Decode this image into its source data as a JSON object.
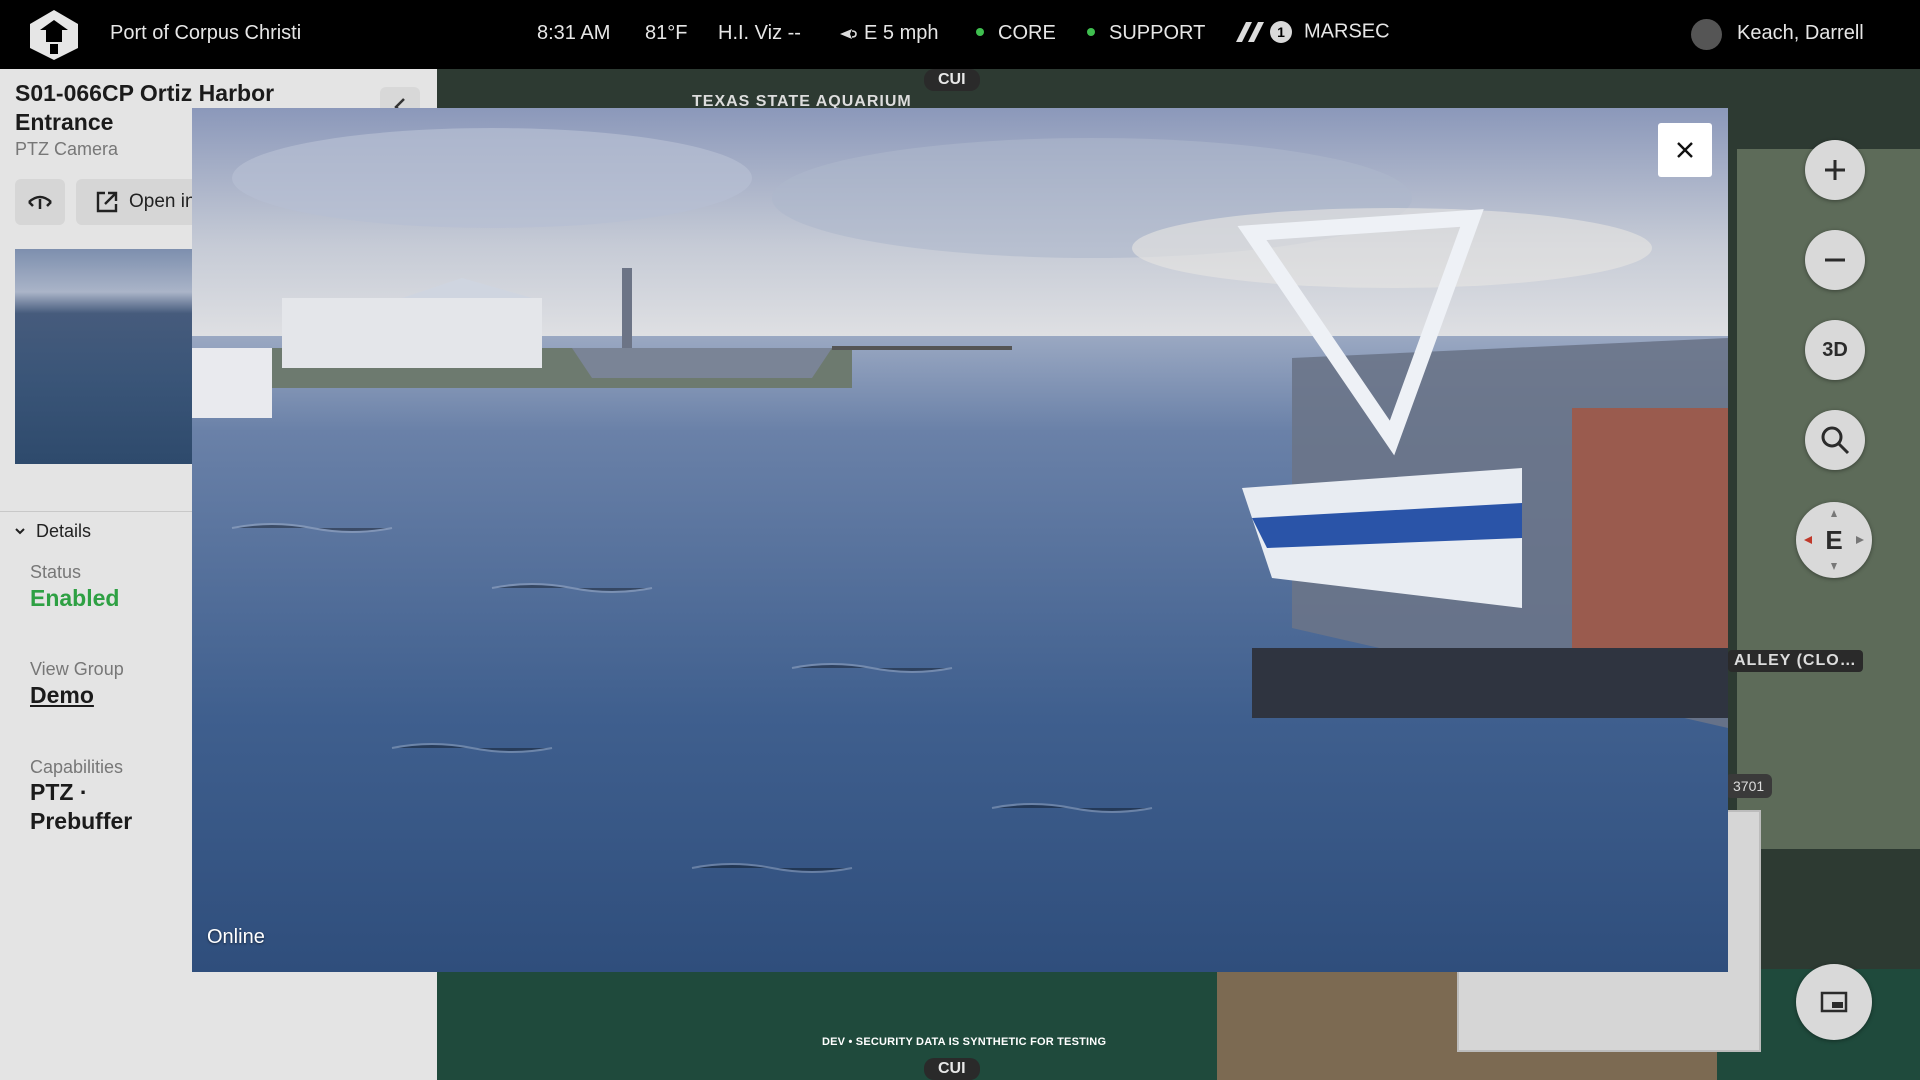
{
  "topbar": {
    "org_name": "Port of Corpus Christi",
    "time": "8:31 AM",
    "temperature": "81°F",
    "visibility": "H.I. Viz --",
    "wind": "E 5 mph",
    "status_core": "CORE",
    "status_support": "SUPPORT",
    "marsec_level": "1",
    "marsec_label": "MARSEC",
    "user_name": "Keach, Darrell",
    "status_color": "#3fbf4f"
  },
  "panel": {
    "title": "S01-066CP Ortiz Harbor Entrance",
    "subtitle": "PTZ Camera",
    "open_label": "Open in",
    "details_header": "Details",
    "status_label": "Status",
    "status_value": "Enabled",
    "view_group_label": "View Group",
    "view_group_value": "Demo",
    "capabilities_label": "Capabilities",
    "capabilities_value": "PTZ · Prebuffer"
  },
  "map": {
    "classification_top": "CUI",
    "classification_bottom": "CUI",
    "aquarium_label": "TEXAS STATE AQUARIUM",
    "valley_label": "ALLEY (CLO…",
    "road_badge": "3701",
    "dev_note": "DEV • SECURITY DATA IS SYNTHETIC FOR TESTING",
    "zoom_in": "+",
    "zoom_out": "−",
    "view_3d": "3D",
    "compass": "E"
  },
  "modal": {
    "stream_status": "Online",
    "close_symbol": "✕"
  }
}
